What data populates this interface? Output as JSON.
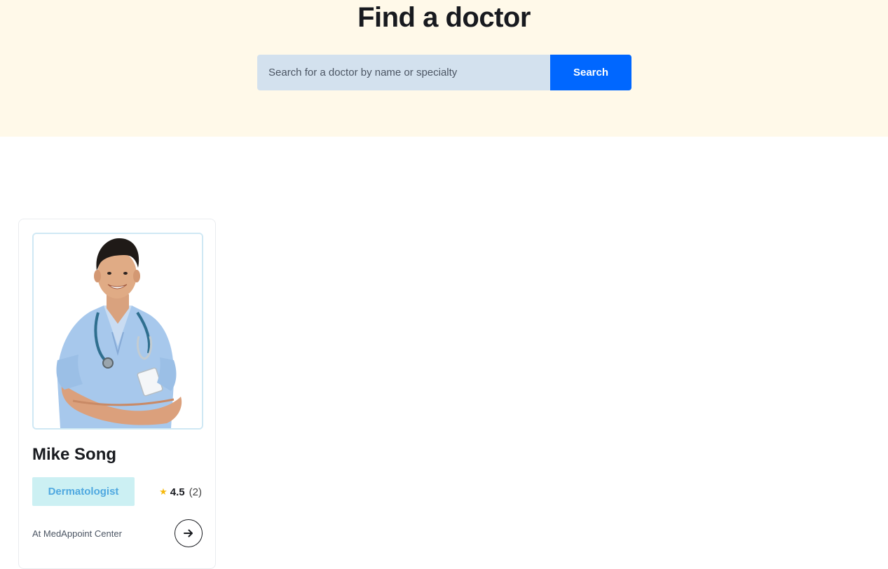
{
  "hero": {
    "title": "Find a doctor",
    "background_color": "#fff9e9"
  },
  "search": {
    "placeholder": "Search for a doctor by name or specialty",
    "value": "",
    "button_label": "Search",
    "accent_color": "#0067ff"
  },
  "doctors": [
    {
      "name": "Mike Song",
      "photo_alt": "Mike Song",
      "specialty": "Dermatologist",
      "rating": "4.5",
      "rating_count": "(2)",
      "hospital": "At MedAppoint Center",
      "star_icon": "star-icon",
      "arrow_icon": "arrow-right-icon"
    }
  ]
}
